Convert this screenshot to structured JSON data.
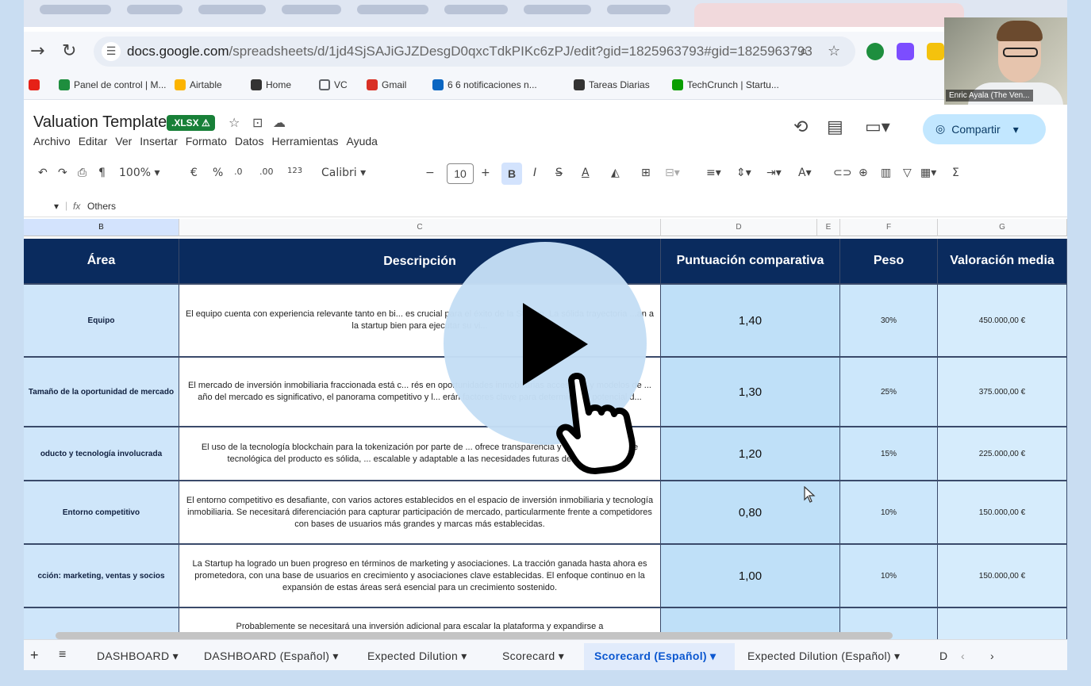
{
  "browser": {
    "url_domain": "docs.google.com",
    "url_path": "/spreadsheets/d/1jd4SjSAJiGJZDesgD0qxcTdkPIKc6zPJ/edit?gid=1825963793#gid=1825963793",
    "bookmarks": [
      {
        "label": "Panel de control | M...",
        "color": "#1e8e3e"
      },
      {
        "label": "Airtable",
        "color": "#fcb400"
      },
      {
        "label": "Home",
        "color": "#333333"
      },
      {
        "label": "VC",
        "color": "#5f6368"
      },
      {
        "label": "Gmail",
        "color": "#d93025"
      },
      {
        "label": "6 6 notificaciones n...",
        "color": "#0a66c2"
      },
      {
        "label": "Tareas Diarias",
        "color": "#333333"
      },
      {
        "label": "TechCrunch | Startu...",
        "color": "#0a9e01"
      }
    ]
  },
  "doc": {
    "title": "Valuation Template",
    "badge": ".XLSX ⚠",
    "menus": [
      "Archivo",
      "Editar",
      "Ver",
      "Insertar",
      "Formato",
      "Datos",
      "Herramientas",
      "Ayuda"
    ],
    "share_label": "Compartir"
  },
  "toolbar": {
    "zoom": "100%",
    "currency": "€",
    "percent": "%",
    "dec_less": ".0",
    "dec_more": ".00",
    "format_123": "123",
    "font": "Calibri",
    "font_size": "10"
  },
  "formula_bar": {
    "fx": "fx",
    "content": "Others"
  },
  "columns": [
    "B",
    "C",
    "D",
    "E",
    "F",
    "G"
  ],
  "table": {
    "headers": {
      "area": "Área",
      "desc": "Descripción",
      "score": "Puntuación comparativa",
      "peso": "Peso",
      "val": "Valoración media"
    },
    "rows": [
      {
        "area": "Equipo",
        "desc": "El equipo cuenta con experiencia relevante tanto en bi... es crucial para el éxito de la Startup. La sólida trayectoria ...an a la startup bien para ejecutar su vi...",
        "score": "1,40",
        "peso": "30%",
        "val": "450.000,00 €"
      },
      {
        "area": "Tamaño de la oportunidad de mercado",
        "desc": "El mercado de inversión inmobiliaria fraccionada está c... rés en oportunidades inmobiliarias accesibles y modelos de ... año del mercado es significativo, el panorama competitivo y l... erán factores clave para determinar el potencial d...",
        "score": "1,30",
        "peso": "25%",
        "val": "375.000,00 €"
      },
      {
        "area": "oducto y tecnología involucrada",
        "desc": "El uso de la tecnología blockchain para la tokenización por parte de ... ofrece transparencia y seguridad. La base tecnológica del producto es sólida, ... escalable y adaptable a las necesidades futuras del mercado.",
        "score": "1,20",
        "peso": "15%",
        "val": "225.000,00 €"
      },
      {
        "area": "Entorno competitivo",
        "desc": "El entorno competitivo es desafiante, con varios actores establecidos en el espacio de inversión inmobiliaria y tecnología inmobiliaria. Se necesitará diferenciación para capturar participación de mercado, particularmente frente a competidores con bases de usuarios más grandes y marcas más establecidas.",
        "score": "0,80",
        "peso": "10%",
        "val": "150.000,00 €"
      },
      {
        "area": "cción: marketing, ventas y socios",
        "desc": "La Startup ha logrado un buen progreso en términos de marketing y asociaciones. La tracción ganada hasta ahora es prometedora, con una base de usuarios en crecimiento y asociaciones clave establecidas. El enfoque continuo en la expansión de estas áreas será esencial para un crecimiento sostenido.",
        "score": "1,00",
        "peso": "10%",
        "val": "150.000,00 €"
      },
      {
        "area": "",
        "desc": "Probablemente se necesitará una inversión adicional para escalar la plataforma y expandirse a",
        "score": "",
        "peso": "",
        "val": ""
      }
    ]
  },
  "sheet_tabs": [
    {
      "label": "DASHBOARD ▾",
      "active": false
    },
    {
      "label": "DASHBOARD (Español) ▾",
      "active": false
    },
    {
      "label": "Expected Dilution ▾",
      "active": false
    },
    {
      "label": "Scorecard ▾",
      "active": false
    },
    {
      "label": "Scorecard (Español) ▾",
      "active": true
    },
    {
      "label": "Expected Dilution (Español) ▾",
      "active": false
    },
    {
      "label": "D",
      "active": false
    }
  ],
  "webcam": {
    "label": "Enric Ayala (The Ven..."
  },
  "colors": {
    "header_navy": "#0a2b5e",
    "accent_blue": "#0b57d0",
    "xlsx_green": "#188038"
  }
}
